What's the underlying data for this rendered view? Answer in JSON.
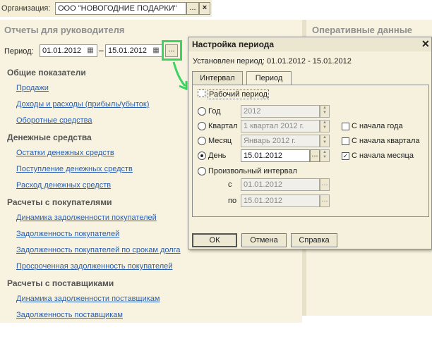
{
  "org": {
    "label": "Организация:",
    "value": "ООО \"НОВОГОДНИЕ ПОДАРКИ\"",
    "select_symbol": "...",
    "clear_symbol": "×"
  },
  "left": {
    "title": "Отчеты для руководителя",
    "period": {
      "label": "Период:",
      "from": "01.01.2012",
      "to": "15.01.2012",
      "dash": "–",
      "more_symbol": "...",
      "calendar_symbol": "▦"
    },
    "sections": [
      {
        "title": "Общие показатели",
        "links": [
          "Продажи",
          "Доходы и расходы (прибыль/убыток)",
          "Оборотные средства"
        ]
      },
      {
        "title": "Денежные средства",
        "links": [
          "Остатки денежных средств",
          "Поступление денежных средств",
          "Расход денежных средств"
        ]
      },
      {
        "title": "Расчеты с покупателями",
        "links": [
          "Динамика задолженности покупателей",
          "Задолженность покупателей",
          "Задолженность покупателей по срокам долга",
          "Просроченная задолженность покупателей"
        ]
      },
      {
        "title": "Расчеты с поставщиками",
        "links": [
          "Динамика задолженности поставщикам",
          "Задолженность поставщикам"
        ]
      }
    ]
  },
  "right": {
    "title": "Оперативные данные"
  },
  "dialog": {
    "title": "Настройка периода",
    "close_symbol": "✕",
    "info": "Установлен период: 01.01.2012 - 15.01.2012",
    "tabs": [
      {
        "label": "Интервал",
        "active": false
      },
      {
        "label": "Период",
        "active": true
      }
    ],
    "working_period_label": "Рабочий период",
    "working_period_checked": false,
    "options": {
      "year": {
        "label": "Год",
        "value": "2012",
        "selected": false
      },
      "quarter": {
        "label": "Квартал",
        "value": "1 квартал 2012 г.",
        "selected": false
      },
      "month": {
        "label": "Месяц",
        "value": "Январь 2012 г.",
        "selected": false
      },
      "day": {
        "label": "День",
        "value": "15.01.2012",
        "selected": true
      },
      "arbitrary": {
        "label": "Произвольный интервал",
        "selected": false,
        "from_label": "с",
        "from": "01.01.2012",
        "to_label": "по",
        "to": "15.01.2012"
      }
    },
    "checks": {
      "year_start": {
        "label": "С начала года",
        "checked": false
      },
      "quarter_start": {
        "label": "С начала квартала",
        "checked": false
      },
      "month_start": {
        "label": "С начала месяца",
        "checked": true
      }
    },
    "buttons": {
      "ok": "ОК",
      "cancel": "Отмена",
      "help": "Справка"
    }
  }
}
